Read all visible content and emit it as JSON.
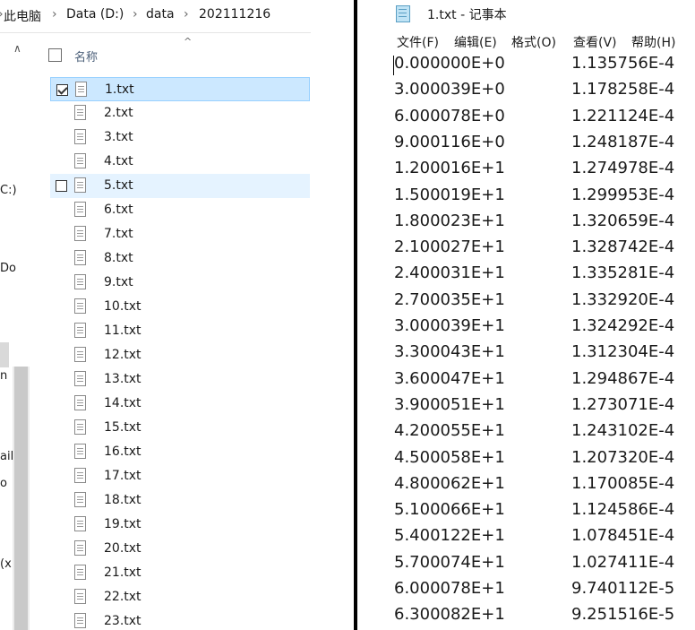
{
  "explorer": {
    "breadcrumb": [
      "此电脑",
      "Data (D:)",
      "data",
      "202111216"
    ],
    "nav_fragments": [
      "C:)",
      "Do",
      "n",
      "ail",
      "o",
      "(x"
    ],
    "column_header": "名称",
    "files": [
      {
        "name": "1.txt",
        "checked": true,
        "state": "selected"
      },
      {
        "name": "2.txt",
        "checked": false,
        "state": ""
      },
      {
        "name": "3.txt",
        "checked": false,
        "state": ""
      },
      {
        "name": "4.txt",
        "checked": false,
        "state": ""
      },
      {
        "name": "5.txt",
        "checked": false,
        "state": "hover"
      },
      {
        "name": "6.txt",
        "checked": false,
        "state": ""
      },
      {
        "name": "7.txt",
        "checked": false,
        "state": ""
      },
      {
        "name": "8.txt",
        "checked": false,
        "state": ""
      },
      {
        "name": "9.txt",
        "checked": false,
        "state": ""
      },
      {
        "name": "10.txt",
        "checked": false,
        "state": ""
      },
      {
        "name": "11.txt",
        "checked": false,
        "state": ""
      },
      {
        "name": "12.txt",
        "checked": false,
        "state": ""
      },
      {
        "name": "13.txt",
        "checked": false,
        "state": ""
      },
      {
        "name": "14.txt",
        "checked": false,
        "state": ""
      },
      {
        "name": "15.txt",
        "checked": false,
        "state": ""
      },
      {
        "name": "16.txt",
        "checked": false,
        "state": ""
      },
      {
        "name": "17.txt",
        "checked": false,
        "state": ""
      },
      {
        "name": "18.txt",
        "checked": false,
        "state": ""
      },
      {
        "name": "19.txt",
        "checked": false,
        "state": ""
      },
      {
        "name": "20.txt",
        "checked": false,
        "state": ""
      },
      {
        "name": "21.txt",
        "checked": false,
        "state": ""
      },
      {
        "name": "22.txt",
        "checked": false,
        "state": ""
      },
      {
        "name": "23.txt",
        "checked": false,
        "state": ""
      }
    ]
  },
  "notepad": {
    "title": "1.txt - 记事本",
    "menu": [
      "文件(F)",
      "编辑(E)",
      "格式(O)",
      "查看(V)",
      "帮助(H)"
    ],
    "lines": [
      [
        "0.000000E+0",
        "1.135756E-4"
      ],
      [
        "3.000039E+0",
        "1.178258E-4"
      ],
      [
        "6.000078E+0",
        "1.221124E-4"
      ],
      [
        "9.000116E+0",
        "1.248187E-4"
      ],
      [
        "1.200016E+1",
        "1.274978E-4"
      ],
      [
        "1.500019E+1",
        "1.299953E-4"
      ],
      [
        "1.800023E+1",
        "1.320659E-4"
      ],
      [
        "2.100027E+1",
        "1.328742E-4"
      ],
      [
        "2.400031E+1",
        "1.335281E-4"
      ],
      [
        "2.700035E+1",
        "1.332920E-4"
      ],
      [
        "3.000039E+1",
        "1.324292E-4"
      ],
      [
        "3.300043E+1",
        "1.312304E-4"
      ],
      [
        "3.600047E+1",
        "1.294867E-4"
      ],
      [
        "3.900051E+1",
        "1.273071E-4"
      ],
      [
        "4.200055E+1",
        "1.243102E-4"
      ],
      [
        "4.500058E+1",
        "1.207320E-4"
      ],
      [
        "4.800062E+1",
        "1.170085E-4"
      ],
      [
        "5.100066E+1",
        "1.124586E-4"
      ],
      [
        "5.400122E+1",
        "1.078451E-4"
      ],
      [
        "5.700074E+1",
        "1.027411E-4"
      ],
      [
        "6.000078E+1",
        "9.740112E-5"
      ],
      [
        "6.300082E+1",
        "9.251516E-5"
      ]
    ]
  }
}
